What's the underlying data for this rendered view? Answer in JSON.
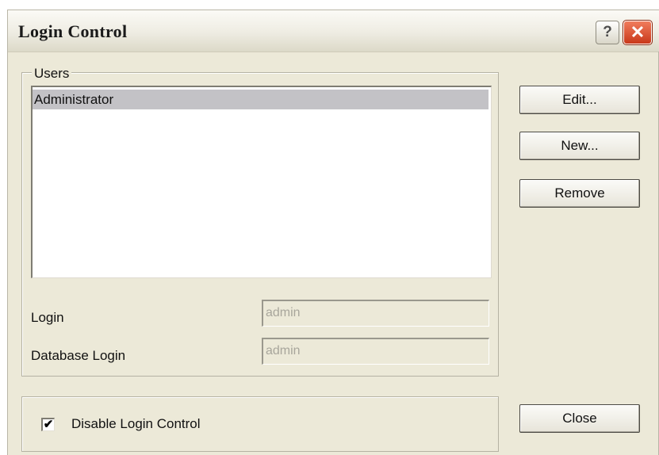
{
  "window": {
    "title": "Login Control",
    "help_icon": "?",
    "close_icon": "✕"
  },
  "users": {
    "group_label": "Users",
    "items": [
      "Administrator"
    ],
    "selected_index": 0
  },
  "fields": {
    "login_label": "Login",
    "login_value": "admin",
    "db_login_label": "Database Login",
    "db_login_value": "admin"
  },
  "buttons": {
    "edit": "Edit...",
    "new": "New...",
    "remove": "Remove",
    "close": "Close"
  },
  "options": {
    "disable_label": "Disable Login Control",
    "disable_checked": true,
    "check_mark": "✔"
  },
  "colors": {
    "dialog_bg": "#ece9d8",
    "selection": "#c3c2c6",
    "close_red": "#c9381a"
  }
}
